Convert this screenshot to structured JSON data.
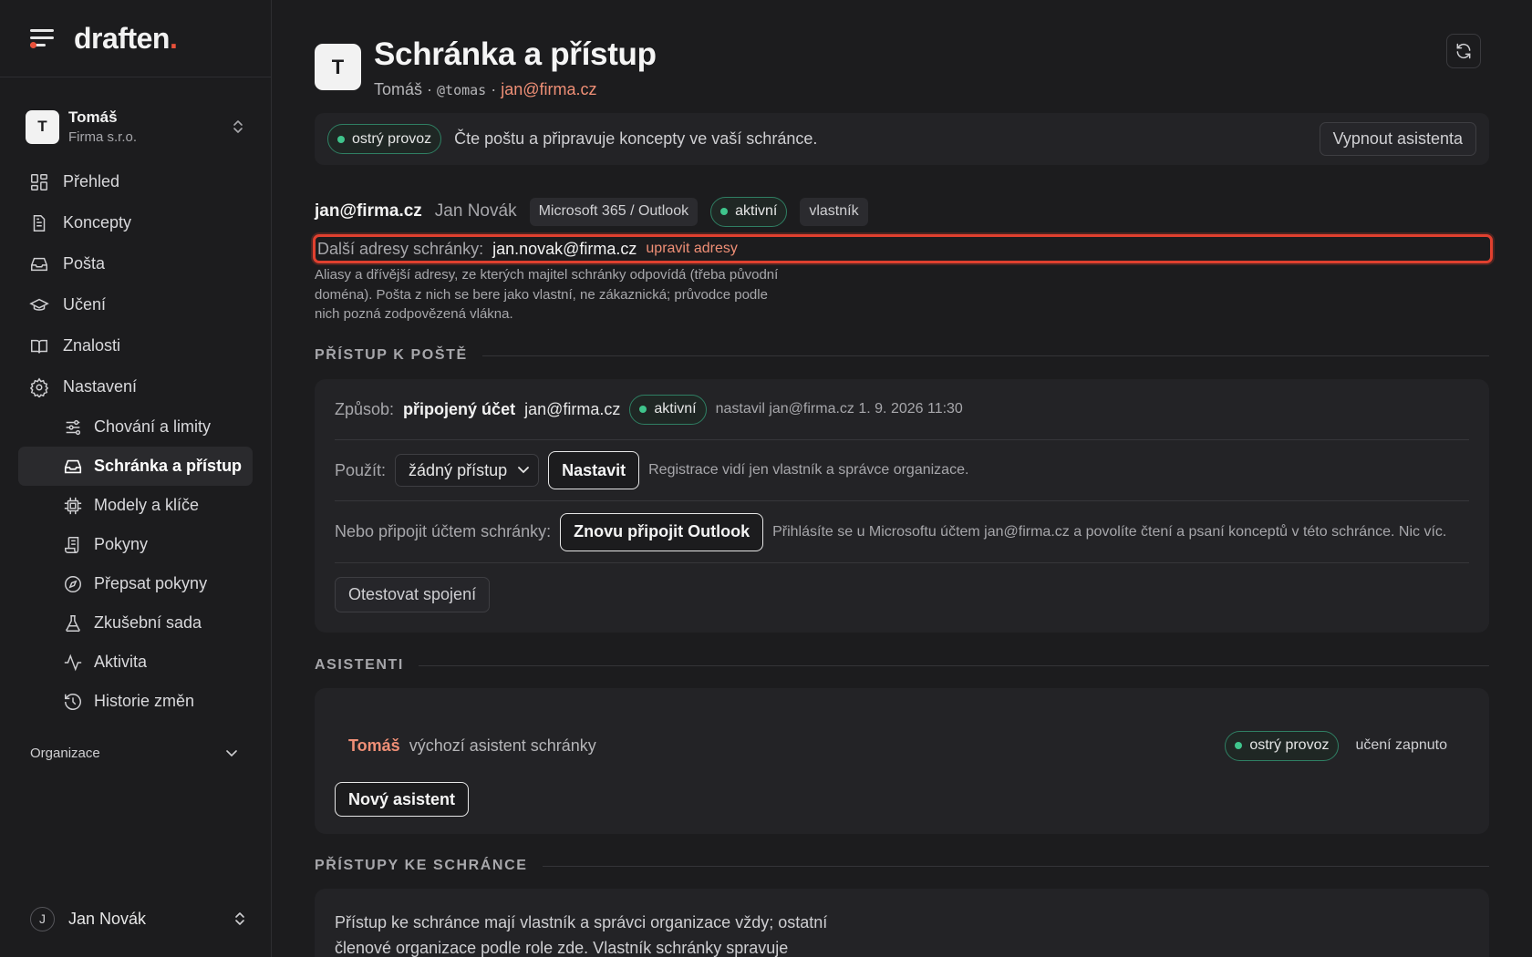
{
  "brand": {
    "name": "draften",
    "dot": "."
  },
  "account": {
    "initial": "T",
    "name": "Tomáš",
    "org": "Firma s.r.o."
  },
  "nav": {
    "items": [
      {
        "label": "Přehled",
        "icon": "dashboard-icon"
      },
      {
        "label": "Koncepty",
        "icon": "document-icon"
      },
      {
        "label": "Pošta",
        "icon": "inbox-icon"
      },
      {
        "label": "Učení",
        "icon": "graduation-cap-icon"
      },
      {
        "label": "Znalosti",
        "icon": "book-icon"
      },
      {
        "label": "Nastavení",
        "icon": "gear-icon"
      }
    ],
    "sub_items": [
      {
        "label": "Chování a limity",
        "icon": "sliders-icon"
      },
      {
        "label": "Schránka a přístup",
        "icon": "inbox-icon",
        "active": true
      },
      {
        "label": "Modely a klíče",
        "icon": "chip-icon"
      },
      {
        "label": "Pokyny",
        "icon": "scroll-icon"
      },
      {
        "label": "Přepsat pokyny",
        "icon": "compass-icon"
      },
      {
        "label": "Zkušební sada",
        "icon": "flask-icon"
      },
      {
        "label": "Aktivita",
        "icon": "activity-icon"
      },
      {
        "label": "Historie změn",
        "icon": "history-icon"
      }
    ],
    "org_label": "Organizace"
  },
  "user": {
    "initial": "J",
    "name": "Jan Novák"
  },
  "header": {
    "initial": "T",
    "title": "Schránka a přístup",
    "name": "Tomáš",
    "sep1": " · ",
    "handle": "@tomas",
    "sep2": " · ",
    "email": "jan@firma.cz"
  },
  "status": {
    "badge": "ostrý provoz",
    "text": "Čte poštu a připravuje koncepty ve vaší schránce.",
    "disable_button": "Vypnout asistenta",
    "badge_color": "#3fc58c"
  },
  "mailbox": {
    "email": "jan@firma.cz",
    "owner": "Jan Novák",
    "provider": "Microsoft 365 / Outlook",
    "state": "aktivní",
    "role": "vlastník",
    "alias_label": "Další adresy schránky:",
    "alias_value": "jan.novak@firma.cz",
    "alias_edit": "upravit adresy",
    "alias_help": "Aliasy a dřívější adresy, ze kterých majitel schránky odpovídá (třeba původní doména). Pošta z nich se bere jako vlastní, ne zákaznická; průvodce podle nich pozná zodpovězená vlákna."
  },
  "access": {
    "section_title": "PŘÍSTUP K POŠTĚ",
    "method_label": "Způsob:",
    "method_value": "připojený účet",
    "method_email": "jan@firma.cz",
    "method_state": "aktivní",
    "method_meta": "nastavil jan@firma.cz 1. 9. 2026 11:30",
    "use_label": "Použít:",
    "use_select": "žádný přístup",
    "use_button": "Nastavit",
    "use_note": "Registrace vidí jen vlastník a správce organizace.",
    "connect_label": "Nebo připojit účtem schránky:",
    "connect_button": "Znovu připojit Outlook",
    "connect_note": "Přihlásíte se u Microsoftu účtem jan@firma.cz a povolíte čtení a psaní konceptů v této schránce. Nic víc.",
    "test_button": "Otestovat spojení"
  },
  "assistants": {
    "section_title": "ASISTENTI",
    "name": "Tomáš",
    "desc": "výchozí asistent schránky",
    "badge": "ostrý provoz",
    "learning": "učení zapnuto",
    "new_button": "Nový asistent"
  },
  "mailbox_access": {
    "section_title": "PŘÍSTUPY KE SCHRÁNCE",
    "text": "Přístup ke schránce mají vlastník a správci organizace vždy; ostatní členové organizace podle role zde. Vlastník schránky spravuje"
  },
  "colors": {
    "accent": "#e8503a",
    "accent_text": "#ef8f76",
    "highlight_border": "#e0402f",
    "success": "#3fc58c"
  }
}
